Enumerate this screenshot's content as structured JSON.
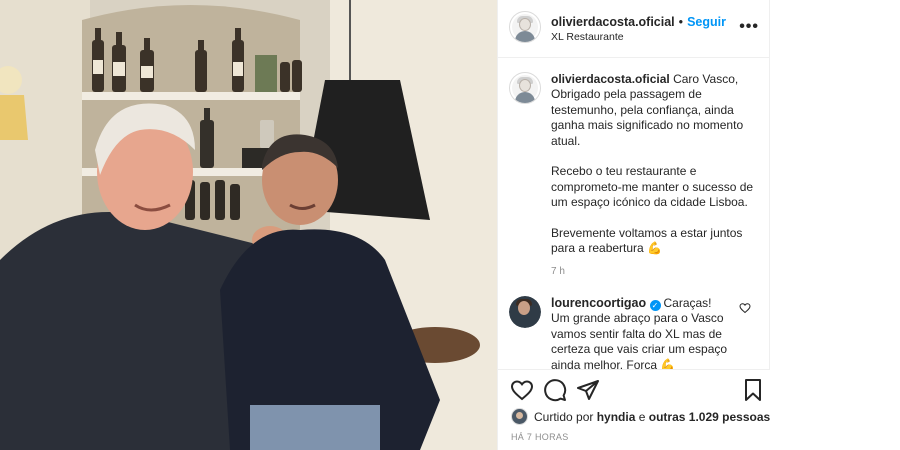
{
  "header": {
    "username": "olivierdacosta.oficial",
    "separator": "•",
    "follow_label": "Seguir",
    "location": "XL Restaurante",
    "more_icon": "more-options-icon",
    "more_label": "•••"
  },
  "caption": {
    "username": "olivierdacosta.oficial",
    "text": "Caro Vasco,\nObrigado pela passagem de testemunho, pela confiança, ainda ganha mais significado no momento atual.\n\nRecebo o teu restaurante e comprometo-me manter o sucesso de um espaço icónico da cidade Lisboa.\n\nBrevemente voltamos a estar juntos para a reabertura",
    "emoji": "💪",
    "time": "7 h"
  },
  "comment": {
    "username": "lourencoortigao",
    "verified_mark": "✓",
    "text": "Caraças! Um grande abraço para o Vasco vamos sentir falta do XL mas de certeza que vais criar um espaço ainda melhor. Força 💪"
  },
  "actions": {
    "icons": [
      "heart-icon",
      "comment-icon",
      "share-icon",
      "bookmark-icon"
    ]
  },
  "likes": {
    "prefix": "Curtido por",
    "user": "hyndia",
    "middle": "e",
    "others": "outras 1.029 pessoas"
  },
  "post_time": "HÁ 7 HORAS",
  "colors": {
    "follow_blue": "#0095f6",
    "border": "#efefef",
    "muted_text": "#8e8e8e"
  }
}
